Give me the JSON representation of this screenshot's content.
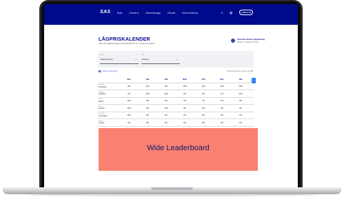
{
  "nav": {
    "logo": "SAS",
    "links": [
      "Boka",
      "Checka in",
      "Mina bokningar",
      "Resmål",
      "SAS EuroBonus"
    ],
    "search_icon": "search-icon",
    "globe_icon": "globe-icon",
    "login_label": "LOGGA IN"
  },
  "page": {
    "title": "LÅGPRISKALENDER",
    "subtitle": "Hitta våra billigaste flygpriser till destinationer inom Sverige och Europa",
    "promo_line1": "SAS & EU Intraneu Upgrade Bag",
    "promo_line2": "Matar av... Beställ vår service"
  },
  "selects": {
    "from_label": "Från",
    "from_value": "Skandinavien",
    "to_label": "Till",
    "to_value": "Europa"
  },
  "filter": {
    "label": "Filtrer och sortering",
    "note": "Priserna visas per person, med SEK"
  },
  "table": {
    "columns": [
      "DEC",
      "JAN",
      "FEB",
      "MAR",
      "APR",
      "MAJ",
      "JUN"
    ],
    "rows": [
      {
        "from": "Stockholm",
        "to": "Stockholm",
        "cells": [
          "995",
          "1089",
          "995",
          "1089",
          "1089",
          "1089",
          "1089"
        ]
      },
      {
        "from": "Göteborg",
        "to": "Göteborg",
        "cells": [
          "995",
          "1089",
          "1299",
          "995",
          "995",
          "1279",
          "1089"
        ]
      },
      {
        "from": "Malmö",
        "to": "Malmö",
        "cells": [
          "1089",
          "995",
          "995",
          "789",
          "799",
          "1279",
          "995"
        ]
      },
      {
        "from": "Alicante",
        "to": "Alicante",
        "cells": [
          "1089",
          "995",
          "1089",
          "995",
          "995",
          "995",
          "995"
        ]
      },
      {
        "from": "Amsterdam",
        "to": "Amsterdam",
        "cells": [
          "1099",
          "995",
          "995",
          "995",
          "995",
          "995",
          "995"
        ]
      },
      {
        "from": "Antalya",
        "to": "Antalya",
        "cells": [
          "995",
          "995",
          "995",
          "995",
          "995",
          "995",
          "995"
        ]
      }
    ],
    "next_icon": "chevron-right-icon"
  },
  "ad": {
    "label": "Wide Leaderboard"
  }
}
